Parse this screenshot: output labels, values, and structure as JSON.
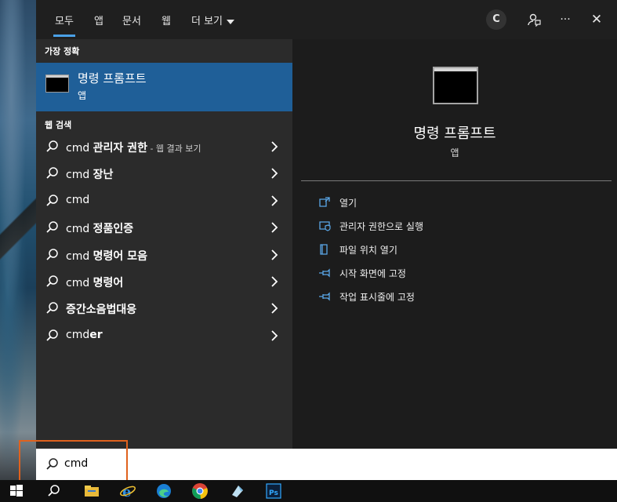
{
  "top_tabs": [
    "모두",
    "앱",
    "문서",
    "웹",
    "더 보기"
  ],
  "avatar_letter": "C",
  "more_icon_label": "···",
  "close_icon_label": "✕",
  "sections": {
    "best_match": "가장 정확",
    "web_search": "웹 검색"
  },
  "best_match": {
    "title": "명령 프롬프트",
    "subtitle": "앱"
  },
  "web_results": [
    {
      "plain": "cmd ",
      "bold": "관리자 권한",
      "suffix": " - 웹 결과 보기"
    },
    {
      "plain": "cmd ",
      "bold": "장난",
      "suffix": ""
    },
    {
      "plain": "cmd",
      "bold": "",
      "suffix": ""
    },
    {
      "plain": "cmd ",
      "bold": "정품인증",
      "suffix": ""
    },
    {
      "plain": "cmd ",
      "bold": "명령어 모음",
      "suffix": ""
    },
    {
      "plain": "cmd ",
      "bold": "명령어",
      "suffix": ""
    },
    {
      "plain": "",
      "bold": "증간소음법대응",
      "suffix": ""
    },
    {
      "plain": "cmd",
      "bold": "er",
      "suffix": ""
    }
  ],
  "detail": {
    "title": "명령 프롬프트",
    "subtitle": "앱",
    "actions": [
      "열기",
      "관리자 권한으로 실행",
      "파일 위치 열기",
      "시작 화면에 고정",
      "작업 표시줄에 고정"
    ]
  },
  "search": {
    "value": "cmd"
  },
  "colors": {
    "accent": "#4aa0e6",
    "selected": "#1f5f98",
    "highlight_box": "#e0621e"
  },
  "taskbar_icons": [
    "windows-start-icon",
    "search-icon",
    "file-explorer-icon",
    "internet-explorer-icon",
    "edge-icon",
    "chrome-icon",
    "app-icon",
    "photoshop-icon"
  ],
  "photoshop_label": "Ps"
}
